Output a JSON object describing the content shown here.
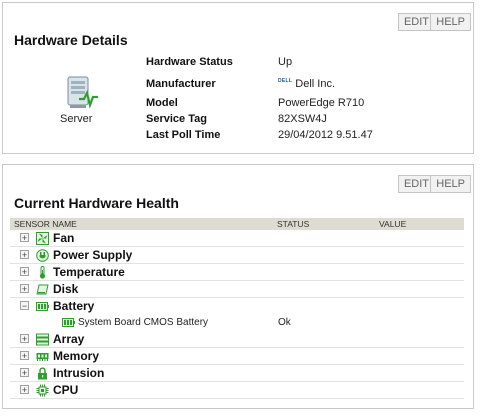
{
  "hardware_details": {
    "title": "Hardware Details",
    "edit_label": "EDIT",
    "help_label": "HELP",
    "server_label": "Server",
    "rows": [
      {
        "label": "Hardware Status",
        "value": "Up"
      },
      {
        "label": "Manufacturer",
        "value": "Dell Inc.",
        "logo_text": "DELL"
      },
      {
        "label": "Model",
        "value": "PowerEdge R710"
      },
      {
        "label": "Service Tag",
        "value": "82XSW4J"
      },
      {
        "label": "Last Poll Time",
        "value": "29/04/2012 9.51.47"
      }
    ]
  },
  "hardware_health": {
    "title": "Current Hardware Health",
    "edit_label": "EDIT",
    "help_label": "HELP",
    "columns": {
      "sensor": "SENSOR NAME",
      "status": "STATUS",
      "value": "VALUE"
    },
    "categories": [
      {
        "name": "Fan",
        "toggle": "+",
        "icon": "fan-icon"
      },
      {
        "name": "Power Supply",
        "toggle": "+",
        "icon": "power-supply-icon"
      },
      {
        "name": "Temperature",
        "toggle": "+",
        "icon": "thermometer-icon"
      },
      {
        "name": "Disk",
        "toggle": "+",
        "icon": "disk-icon"
      },
      {
        "name": "Battery",
        "toggle": "−",
        "icon": "battery-icon",
        "children": [
          {
            "name": "System Board CMOS Battery",
            "status": "Ok",
            "icon": "battery-icon"
          }
        ]
      },
      {
        "name": "Array",
        "toggle": "+",
        "icon": "array-icon"
      },
      {
        "name": "Memory",
        "toggle": "+",
        "icon": "memory-icon"
      },
      {
        "name": "Intrusion",
        "toggle": "+",
        "icon": "lock-icon"
      },
      {
        "name": "CPU",
        "toggle": "+",
        "icon": "cpu-icon"
      }
    ]
  },
  "colors": {
    "accent_green": "#2e9e2e",
    "header_bg": "#dcdcd0"
  }
}
